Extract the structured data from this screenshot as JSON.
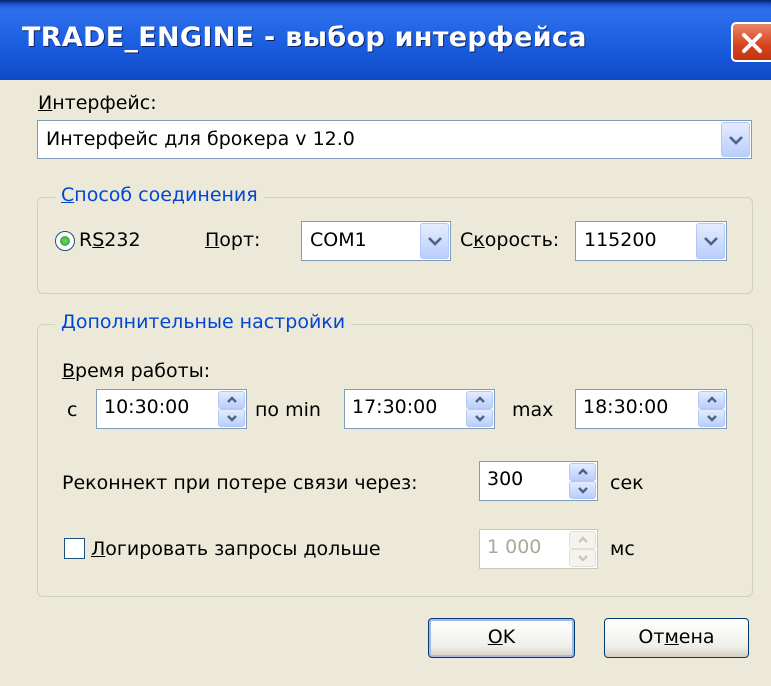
{
  "window": {
    "title": "TRADE_ENGINE - выбор интерфейса",
    "close_icon": "close-icon"
  },
  "interface": {
    "label_u": "И",
    "label_rest": "нтерфейс:",
    "value": "Интерфейс для брокера v 12.0"
  },
  "connection": {
    "group_title_u": "С",
    "group_title_rest": "пособ соединения",
    "rs232_label_pre": "R",
    "rs232_label_u": "S",
    "rs232_label_rest": "232",
    "port_label_u": "П",
    "port_label_rest": "орт:",
    "port_value": "COM1",
    "speed_label_pre": "С",
    "speed_label_u": "к",
    "speed_label_rest": "орость:",
    "speed_value": "115200"
  },
  "advanced": {
    "group_title_u": "Д",
    "group_title_rest": "ополнительные настройки",
    "work_time_label_u": "В",
    "work_time_label_rest": "ремя работы:",
    "from_label": "с",
    "from_value": "10:30:00",
    "to_min_label": "по min",
    "to_min_value": "17:30:00",
    "max_label": "max",
    "max_value": "18:30:00",
    "reconnect_label": "Реконнект при потере связи через:",
    "reconnect_value": "300",
    "reconnect_unit": "сек",
    "log_label_u": "Л",
    "log_label_rest": "огировать запросы дольше",
    "log_checked": false,
    "log_value": "1 000",
    "log_unit": "мс"
  },
  "buttons": {
    "ok_u": "О",
    "ok_rest": "K",
    "cancel_pre": "От",
    "cancel_u": "м",
    "cancel_rest": "ена"
  },
  "colors": {
    "title_bar": "#1B5FE0",
    "group_title": "#0046D5",
    "close_button": "#D5421D",
    "dialog_bg": "#ECE9D8"
  }
}
